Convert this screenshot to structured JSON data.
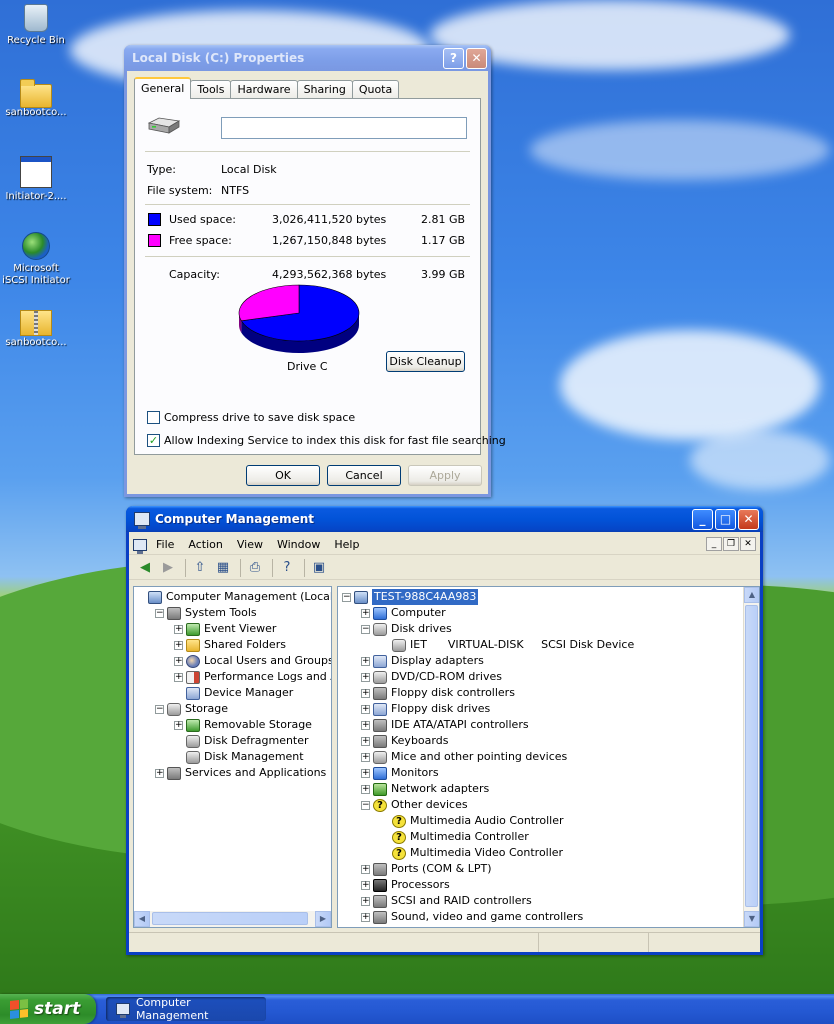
{
  "desktop": {
    "icons": [
      {
        "label": "Recycle Bin",
        "icon": "recycle-bin-icon"
      },
      {
        "label": "sanbootco...",
        "icon": "folder-icon"
      },
      {
        "label": "Initiator-2....",
        "icon": "application-window-icon"
      },
      {
        "label": "Microsoft iSCSI Initiator",
        "icon": "globe-shortcut-icon"
      },
      {
        "label": "sanbootco...",
        "icon": "zip-folder-icon"
      }
    ]
  },
  "properties": {
    "title": "Local Disk (C:) Properties",
    "tabs": [
      "General",
      "Tools",
      "Hardware",
      "Sharing",
      "Quota"
    ],
    "active_tab": "General",
    "volume_label_value": "",
    "type_label": "Type:",
    "type_value": "Local Disk",
    "fs_label": "File system:",
    "fs_value": "NTFS",
    "used_label": "Used space:",
    "used_bytes": "3,026,411,520 bytes",
    "used_gb": "2.81 GB",
    "free_label": "Free space:",
    "free_bytes": "1,267,150,848 bytes",
    "free_gb": "1.17 GB",
    "capacity_label": "Capacity:",
    "capacity_bytes": "4,293,562,368 bytes",
    "capacity_gb": "3.99 GB",
    "drive_label": "Drive C",
    "disk_cleanup": "Disk Cleanup",
    "compress_label": "Compress drive to save disk space",
    "compress_checked": false,
    "index_label": "Allow Indexing Service to index this disk for fast file searching",
    "index_checked": true,
    "ok": "OK",
    "cancel": "Cancel",
    "apply": "Apply",
    "used_fraction": 0.705,
    "colors": {
      "used": "#0000ff",
      "free": "#ff00ff"
    }
  },
  "mgmt": {
    "title": "Computer Management",
    "menu": [
      "File",
      "Action",
      "View",
      "Window",
      "Help"
    ],
    "toolbar_icons": [
      "back-arrow-icon",
      "forward-arrow-icon",
      "up-folder-icon",
      "show-hide-tree-icon",
      "print-icon",
      "help-icon",
      "properties-icon"
    ],
    "left_tree": [
      {
        "label": "Computer Management (Local)",
        "level": 0,
        "expander": "",
        "icon": "pc"
      },
      {
        "label": "System Tools",
        "level": 1,
        "expander": "−",
        "icon": "tools"
      },
      {
        "label": "Event Viewer",
        "level": 2,
        "expander": "+",
        "icon": "green"
      },
      {
        "label": "Shared Folders",
        "level": 2,
        "expander": "+",
        "icon": "folder"
      },
      {
        "label": "Local Users and Groups",
        "level": 2,
        "expander": "+",
        "icon": "users"
      },
      {
        "label": "Performance Logs and Alerts",
        "level": 2,
        "expander": "+",
        "icon": "chart"
      },
      {
        "label": "Device Manager",
        "level": 2,
        "expander": "",
        "icon": "dev"
      },
      {
        "label": "Storage",
        "level": 1,
        "expander": "−",
        "icon": "disk"
      },
      {
        "label": "Removable Storage",
        "level": 2,
        "expander": "+",
        "icon": "green"
      },
      {
        "label": "Disk Defragmenter",
        "level": 2,
        "expander": "",
        "icon": "disk"
      },
      {
        "label": "Disk Management",
        "level": 2,
        "expander": "",
        "icon": "disk"
      },
      {
        "label": "Services and Applications",
        "level": 1,
        "expander": "+",
        "icon": "tools"
      }
    ],
    "right_tree": [
      {
        "label": "TEST-988C4AA983",
        "level": 0,
        "expander": "−",
        "icon": "pc",
        "selected": true
      },
      {
        "label": "Computer",
        "level": 1,
        "expander": "+",
        "icon": "blue"
      },
      {
        "label": "Disk drives",
        "level": 1,
        "expander": "−",
        "icon": "disk"
      },
      {
        "label": "IET      VIRTUAL-DISK     SCSI Disk Device",
        "level": 2,
        "expander": "",
        "icon": "disk"
      },
      {
        "label": "Display adapters",
        "level": 1,
        "expander": "+",
        "icon": "dev"
      },
      {
        "label": "DVD/CD-ROM drives",
        "level": 1,
        "expander": "+",
        "icon": "disk"
      },
      {
        "label": "Floppy disk controllers",
        "level": 1,
        "expander": "+",
        "icon": "tools"
      },
      {
        "label": "Floppy disk drives",
        "level": 1,
        "expander": "+",
        "icon": "dev"
      },
      {
        "label": "IDE ATA/ATAPI controllers",
        "level": 1,
        "expander": "+",
        "icon": "tools"
      },
      {
        "label": "Keyboards",
        "level": 1,
        "expander": "+",
        "icon": "tools"
      },
      {
        "label": "Mice and other pointing devices",
        "level": 1,
        "expander": "+",
        "icon": "disk"
      },
      {
        "label": "Monitors",
        "level": 1,
        "expander": "+",
        "icon": "blue"
      },
      {
        "label": "Network adapters",
        "level": 1,
        "expander": "+",
        "icon": "net"
      },
      {
        "label": "Other devices",
        "level": 1,
        "expander": "−",
        "icon": "warn"
      },
      {
        "label": "Multimedia Audio Controller",
        "level": 2,
        "expander": "",
        "icon": "warn"
      },
      {
        "label": "Multimedia Controller",
        "level": 2,
        "expander": "",
        "icon": "warn"
      },
      {
        "label": "Multimedia Video Controller",
        "level": 2,
        "expander": "",
        "icon": "warn"
      },
      {
        "label": "Ports (COM & LPT)",
        "level": 1,
        "expander": "+",
        "icon": "tools"
      },
      {
        "label": "Processors",
        "level": 1,
        "expander": "+",
        "icon": "black"
      },
      {
        "label": "SCSI and RAID controllers",
        "level": 1,
        "expander": "+",
        "icon": "tools"
      },
      {
        "label": "Sound, video and game controllers",
        "level": 1,
        "expander": "+",
        "icon": "tools"
      }
    ]
  },
  "taskbar": {
    "start": "start",
    "items": [
      {
        "label": "Computer Management"
      }
    ]
  }
}
